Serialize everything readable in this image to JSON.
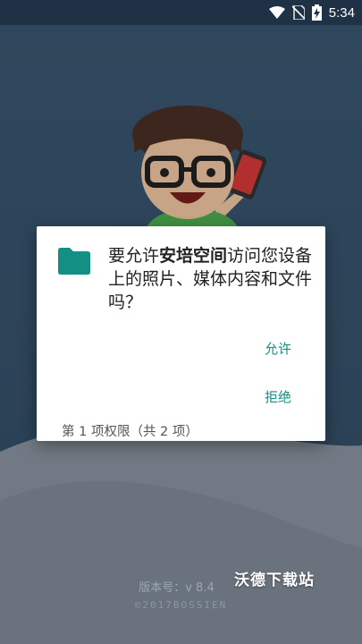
{
  "status_bar": {
    "time": "5:34",
    "icons": [
      "wifi-icon",
      "no-sim-icon",
      "battery-charging-icon"
    ]
  },
  "dialog": {
    "icon": "folder-icon",
    "message_prefix": "要允许",
    "app_name": "安培空间",
    "message_suffix": "访问您设备上的照片、媒体内容和文件吗？",
    "allow_label": "允许",
    "deny_label": "拒绝",
    "footer": "第 1 项权限（共 2 项）",
    "accent_color": "#148f84"
  },
  "splash": {
    "version": "版本号：v 8.4",
    "copyright": "©2017BOSSIEN",
    "watermark": "沃德下载站"
  }
}
